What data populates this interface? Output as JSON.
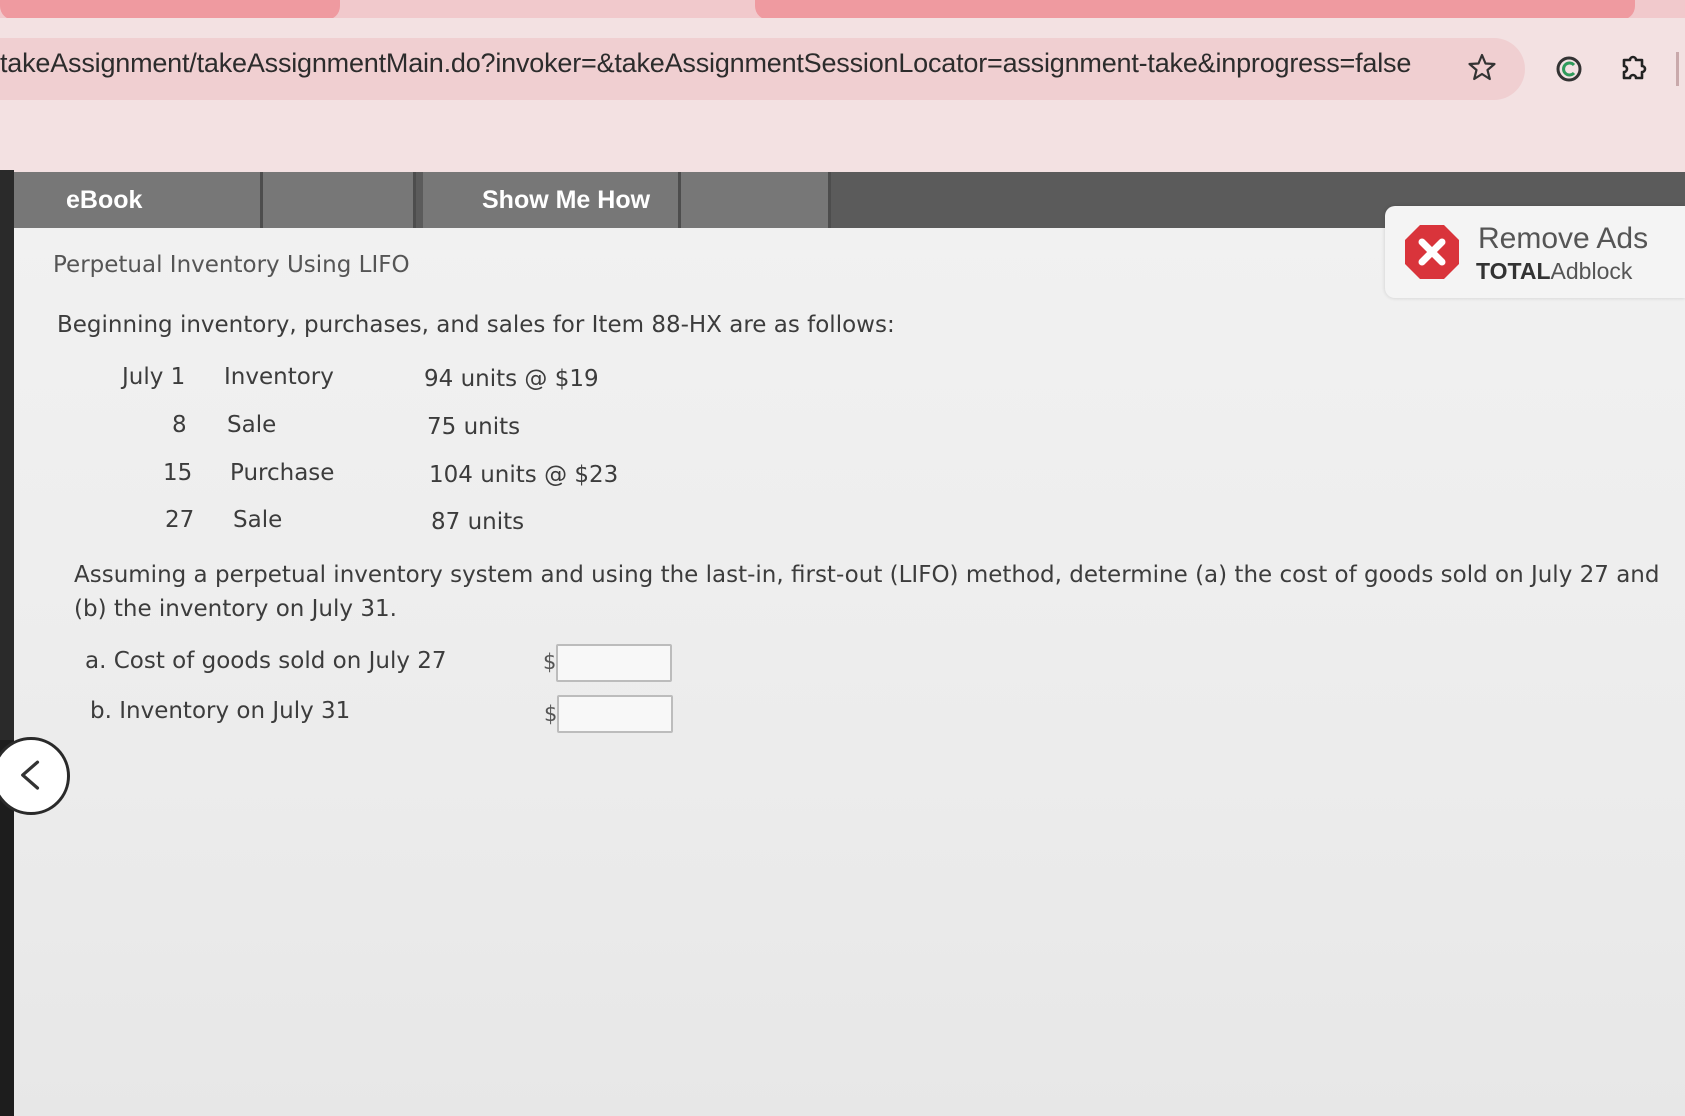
{
  "browser": {
    "url": "takeAssignment/takeAssignmentMain.do?invoker=&takeAssignmentSessionLocator=assignment-take&inprogress=false",
    "icons": [
      "star-icon",
      "extension-icon",
      "puzzle-icon"
    ]
  },
  "toolbar": {
    "ebook_label": "eBook",
    "show_me_how_label": "Show Me How"
  },
  "problem": {
    "title": "Perpetual Inventory Using LIFO",
    "intro": "Beginning inventory, purchases, and sales for Item 88-HX are as follows:",
    "rows": [
      {
        "day": "July 1",
        "type": "Inventory",
        "qty": "94 units @ $19"
      },
      {
        "day": "8",
        "type": "Sale",
        "qty": "75 units"
      },
      {
        "day": "15",
        "type": "Purchase",
        "qty": "104 units @ $23"
      },
      {
        "day": "27",
        "type": "Sale",
        "qty": "87 units"
      }
    ],
    "question": "Assuming a perpetual inventory system and using the last-in, first-out (LIFO) method, determine (a) the cost of goods sold on July 27 and (b) the inventory on July 31.",
    "answers": [
      {
        "label": "a. Cost of goods sold on July 27",
        "currency": "$",
        "value": ""
      },
      {
        "label": "b. Inventory on July 31",
        "currency": "$",
        "value": ""
      }
    ]
  },
  "ad": {
    "title": "Remove Ads",
    "brand_bold": "TOTAL",
    "brand_rest": "Adblock",
    "color": "#d9343b"
  }
}
